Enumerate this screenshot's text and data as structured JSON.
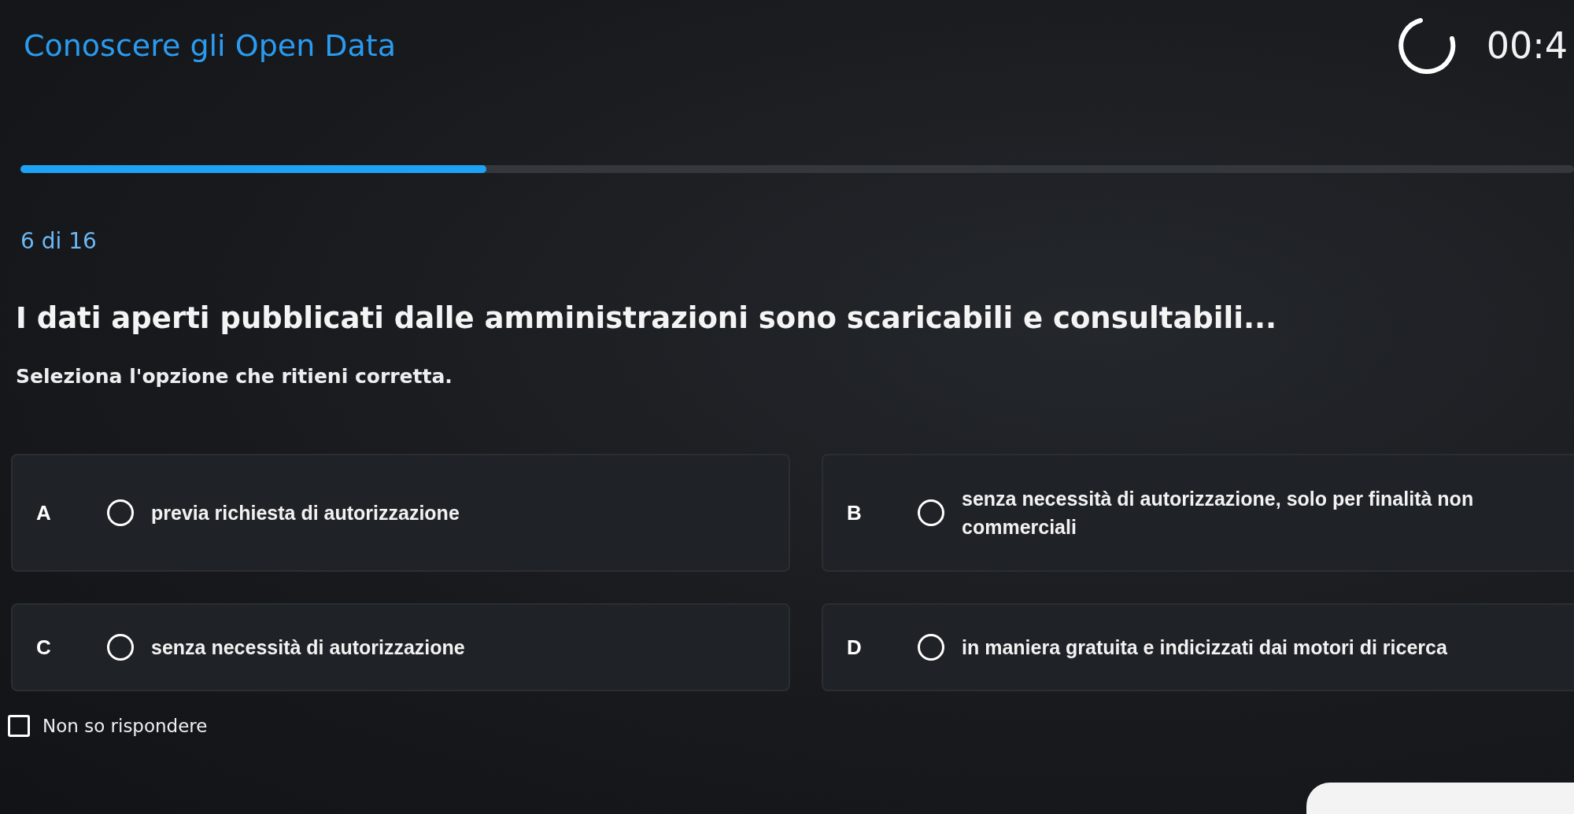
{
  "header": {
    "title": "Conoscere gli Open Data",
    "timer": "00:4"
  },
  "progress": {
    "level": 0.3
  },
  "counter": "6 di 16",
  "question": "I dati aperti pubblicati dalle amministrazioni sono scaricabili e consultabili...",
  "instruction": "Seleziona l'opzione che ritieni corretta.",
  "option_rows": [
    {
      "options": [
        {
          "letter": "A",
          "text": "previa richiesta di autorizzazione",
          "selected": false
        },
        {
          "letter": "B",
          "text": "senza necessità di autorizzazione, solo per finalità non commerciali",
          "selected": false
        }
      ]
    },
    {
      "options": [
        {
          "letter": "C",
          "text": "senza necessità di autorizzazione",
          "selected": false
        },
        {
          "letter": "D",
          "text": "in maniera gratuita e indicizzati dai motori di ricerca",
          "selected": false
        }
      ]
    }
  ],
  "skip": {
    "label": "Non so rispondere",
    "checked": false
  }
}
